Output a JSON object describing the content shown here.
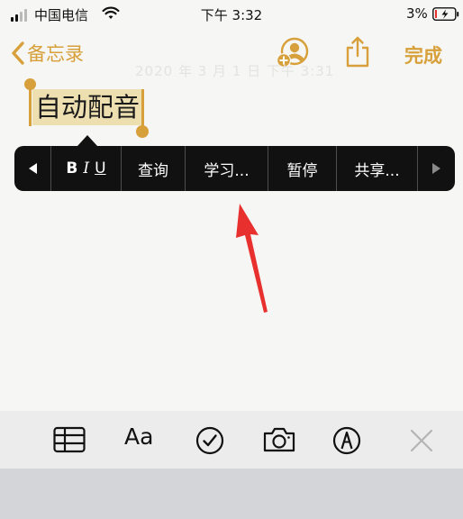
{
  "status_bar": {
    "carrier": "中国电信",
    "time": "下午 3:32",
    "battery_percent": "3%",
    "signal_bars_active": 2,
    "signal_bars_total": 4,
    "icons": [
      "signal-icon",
      "wifi-icon",
      "battery-charging-icon"
    ]
  },
  "nav": {
    "back_label": "备忘录",
    "done_label": "完成",
    "icons": [
      "chevron-left-icon",
      "add-person-icon",
      "share-icon"
    ],
    "accent_color": "#d7a03a"
  },
  "note": {
    "faded_header": "2020 年 3 月 1 日 下午 3:31",
    "selected_text": "自动配音",
    "selection_color": "#eedfb0"
  },
  "edit_menu": {
    "bold": "B",
    "italic": "I",
    "underline": "U",
    "items": [
      "查询",
      "学习...",
      "暂停",
      "共享..."
    ],
    "icons": [
      "arrow-left-icon",
      "arrow-right-icon"
    ]
  },
  "annotation": {
    "arrow_color": "#e8302f"
  },
  "toolbar": {
    "format_label": "Aa",
    "icons": [
      "table-icon",
      "checklist-icon",
      "camera-icon",
      "markup-icon",
      "close-icon"
    ]
  }
}
